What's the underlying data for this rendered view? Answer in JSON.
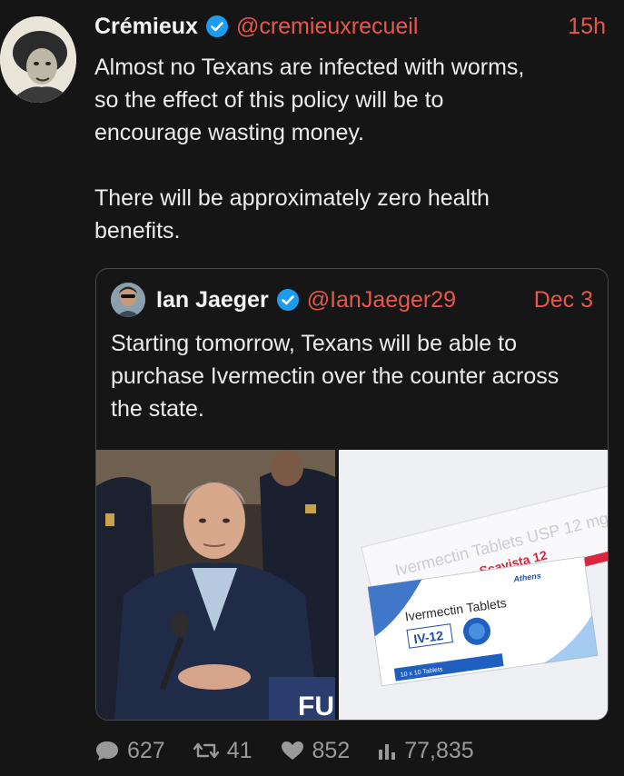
{
  "tweet": {
    "display_name": "Crémieux",
    "handle": "@cremieuxrecueil",
    "time": "15h",
    "text": "Almost no Texans are infected with worms,\nso the effect of this policy will be to\nencourage wasting money.\n\nThere will be approximately zero health\nbenefits."
  },
  "quoted": {
    "display_name": "Ian Jaeger",
    "handle": "@IanJaeger29",
    "date": "Dec 3",
    "text": "Starting tomorrow, Texans will be able to purchase Ivermectin over the counter across the state.",
    "image_right": {
      "box_brand": "Athens",
      "box_title": "Ivermectin Tablets",
      "box_code": "IV-12",
      "box_count": "10 x 10 Tablets",
      "back_box_label": "Ivermectin Tablets USP 12 mg",
      "back_box_brand": "Scavista 12"
    },
    "image_left": {
      "podium_text": "FU"
    }
  },
  "stats": {
    "replies": "627",
    "retweets": "41",
    "likes": "852",
    "views": "77,835"
  },
  "colors": {
    "background": "#151515",
    "accent": "#e8574c",
    "verified": "#1d9bf0",
    "muted": "#9a9a9a"
  }
}
